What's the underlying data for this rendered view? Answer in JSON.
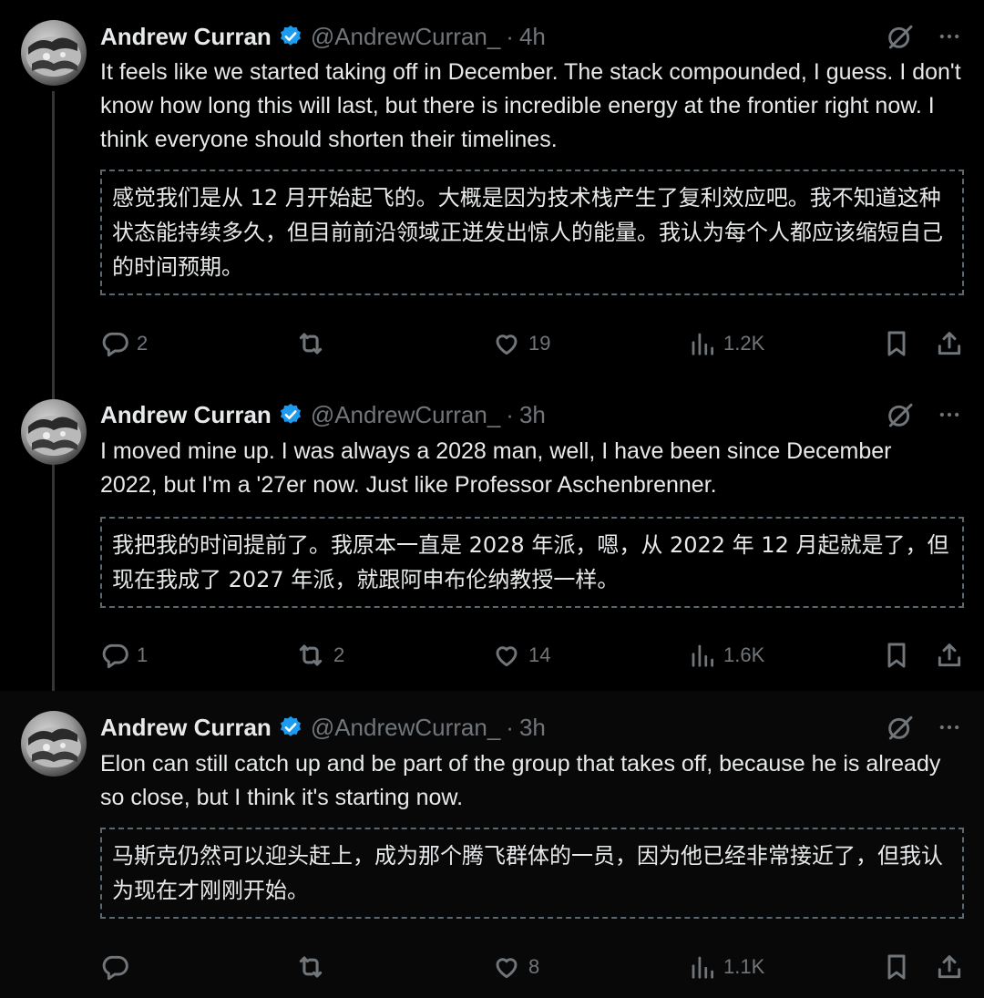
{
  "colors": {
    "background": "#000000",
    "text": "#e7e9ea",
    "muted": "#71767b",
    "verified": "#1d9bf0",
    "translation_border": "#5c6870"
  },
  "tweets": [
    {
      "author": "Andrew Curran",
      "handle": "@AndrewCurran_",
      "separator": "·",
      "time": "4h",
      "text": "It feels like we started taking off in December. The stack compounded, I guess. I don't know how long this will last, but there is incredible energy at the frontier right now. I think everyone should shorten their timelines.",
      "translation": "感觉我们是从 12 月开始起飞的。大概是因为技术栈产生了复利效应吧。我不知道这种状态能持续多久，但目前前沿领域正迸发出惊人的能量。我认为每个人都应该缩短自己的时间预期。",
      "replies": "2",
      "reposts": "",
      "likes": "19",
      "views": "1.2K"
    },
    {
      "author": "Andrew Curran",
      "handle": "@AndrewCurran_",
      "separator": "·",
      "time": "3h",
      "text": "I moved mine up. I was always a 2028 man, well, I have been since December 2022, but I'm a '27er now. Just like Professor Aschenbrenner.",
      "translation": "我把我的时间提前了。我原本一直是 2028 年派，嗯，从 2022 年 12 月起就是了，但现在我成了 2027 年派，就跟阿申布伦纳教授一样。",
      "replies": "1",
      "reposts": "2",
      "likes": "14",
      "views": "1.6K"
    },
    {
      "author": "Andrew Curran",
      "handle": "@AndrewCurran_",
      "separator": "·",
      "time": "3h",
      "text": "Elon can still catch up and be part of the group that takes off, because he is already so close, but I think it's starting now.",
      "translation": "马斯克仍然可以迎头赶上，成为那个腾飞群体的一员，因为他已经非常接近了，但我认为现在才刚刚开始。",
      "replies": "",
      "reposts": "",
      "likes": "8",
      "views": "1.1K"
    }
  ],
  "icons": {
    "avatar": "avatar-image",
    "verified": "verified-badge-icon",
    "grok": "grok-icon",
    "more": "more-icon",
    "reply": "reply-icon",
    "repost": "repost-icon",
    "like": "like-icon",
    "views": "views-icon",
    "bookmark": "bookmark-icon",
    "share": "share-icon"
  }
}
